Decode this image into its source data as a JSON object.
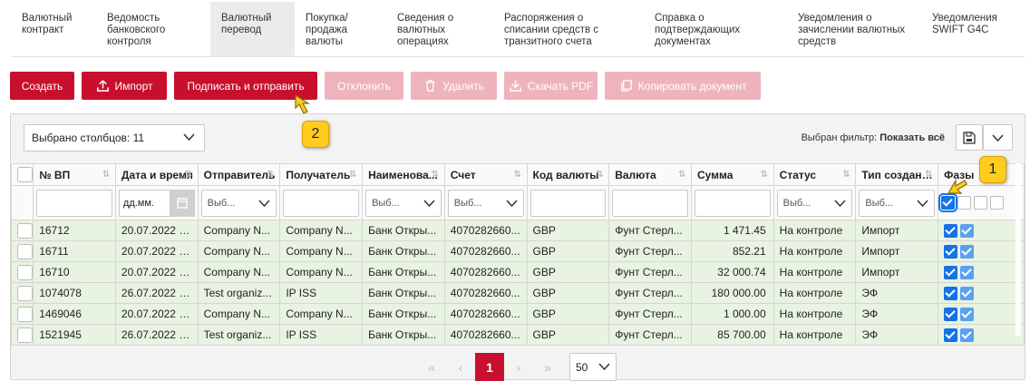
{
  "tabs": [
    {
      "label": "Валютный\nконтракт"
    },
    {
      "label": "Ведомость\nбанковского\nконтроля"
    },
    {
      "label": "Валютный\nперевод",
      "active": true
    },
    {
      "label": "Покупка/\nпродажа\nвалюты"
    },
    {
      "label": "Сведения о\nвалютных\nоперациях"
    },
    {
      "label": "Распоряжения о\nсписании средств с\nтранзитного счета"
    },
    {
      "label": "Справка о\nподтверждающих\nдокументах"
    },
    {
      "label": "Уведомления о\nзачислении валютных\nсредств"
    },
    {
      "label": "Уведомления\nSWIFT G4C"
    }
  ],
  "toolbar": {
    "create": "Создать",
    "import": "Импорт",
    "sign_send": "Подписать и отправить",
    "reject": "Отклонить",
    "delete": "Удалить",
    "pdf": "Скачать PDF",
    "copy": "Копировать документ"
  },
  "columns_select": "Выбрано столбцов: 11",
  "filter": {
    "prefix": "Выбран фильтр:",
    "value": "Показать всё"
  },
  "headers": [
    "№ ВП",
    "Дата и время",
    "Отправитель",
    "Получатель",
    "Наименова...",
    "Счет",
    "Код валюты",
    "Валюта",
    "Сумма",
    "Статус",
    "Тип создания",
    "Фазы"
  ],
  "filters": {
    "date_placeholder": "дд.мм.",
    "select_placeholder": "Выб..."
  },
  "rows": [
    {
      "num": "16712",
      "date": "20.07.2022 0...",
      "sender": "Company N...",
      "recipient": "Company N...",
      "name": "Банк Откры...",
      "account": "4070282660...",
      "code": "GBP",
      "currency": "Фунт Стерл...",
      "amount": "1 471.45",
      "status": "На контроле",
      "type": "Импорт"
    },
    {
      "num": "16711",
      "date": "20.07.2022 0...",
      "sender": "Company N...",
      "recipient": "Company N...",
      "name": "Банк Откры...",
      "account": "4070282660...",
      "code": "GBP",
      "currency": "Фунт Стерл...",
      "amount": "852.21",
      "status": "На контроле",
      "type": "Импорт"
    },
    {
      "num": "16710",
      "date": "20.07.2022 0...",
      "sender": "Company N...",
      "recipient": "Company N...",
      "name": "Банк Откры...",
      "account": "4070282660...",
      "code": "GBP",
      "currency": "Фунт Стерл...",
      "amount": "32 000.74",
      "status": "На контроле",
      "type": "Импорт"
    },
    {
      "num": "1074078",
      "date": "26.07.2022 0...",
      "sender": "Test organiz...",
      "recipient": "IP ISS",
      "name": "Банк Откры...",
      "account": "4070282660...",
      "code": "GBP",
      "currency": "Фунт Стерл...",
      "amount": "180 000.00",
      "status": "На контроле",
      "type": "ЭФ"
    },
    {
      "num": "1469046",
      "date": "20.07.2022 0...",
      "sender": "Company N...",
      "recipient": "Company N...",
      "name": "Банк Откры...",
      "account": "4070282660...",
      "code": "GBP",
      "currency": "Фунт Стерл...",
      "amount": "1 000.00",
      "status": "На контроле",
      "type": "ЭФ"
    },
    {
      "num": "1521945",
      "date": "26.07.2022 0...",
      "sender": "Test organiz...",
      "recipient": "IP ISS",
      "name": "Банк Откры...",
      "account": "4070282660...",
      "code": "GBP",
      "currency": "Фунт Стерл...",
      "amount": "85 700.00",
      "status": "На контроле",
      "type": "ЭФ"
    }
  ],
  "pager": {
    "first": "«",
    "prev": "‹",
    "current": "1",
    "next": "›",
    "last": "»",
    "per_page": "50"
  },
  "markers": {
    "m1": "1",
    "m2": "2"
  },
  "colors": {
    "accent": "#c8102e",
    "accent_disabled": "#eeb3bd",
    "row_bg": "#e8f3e2",
    "marker": "#ffcc1f",
    "check": "#1473e6"
  }
}
